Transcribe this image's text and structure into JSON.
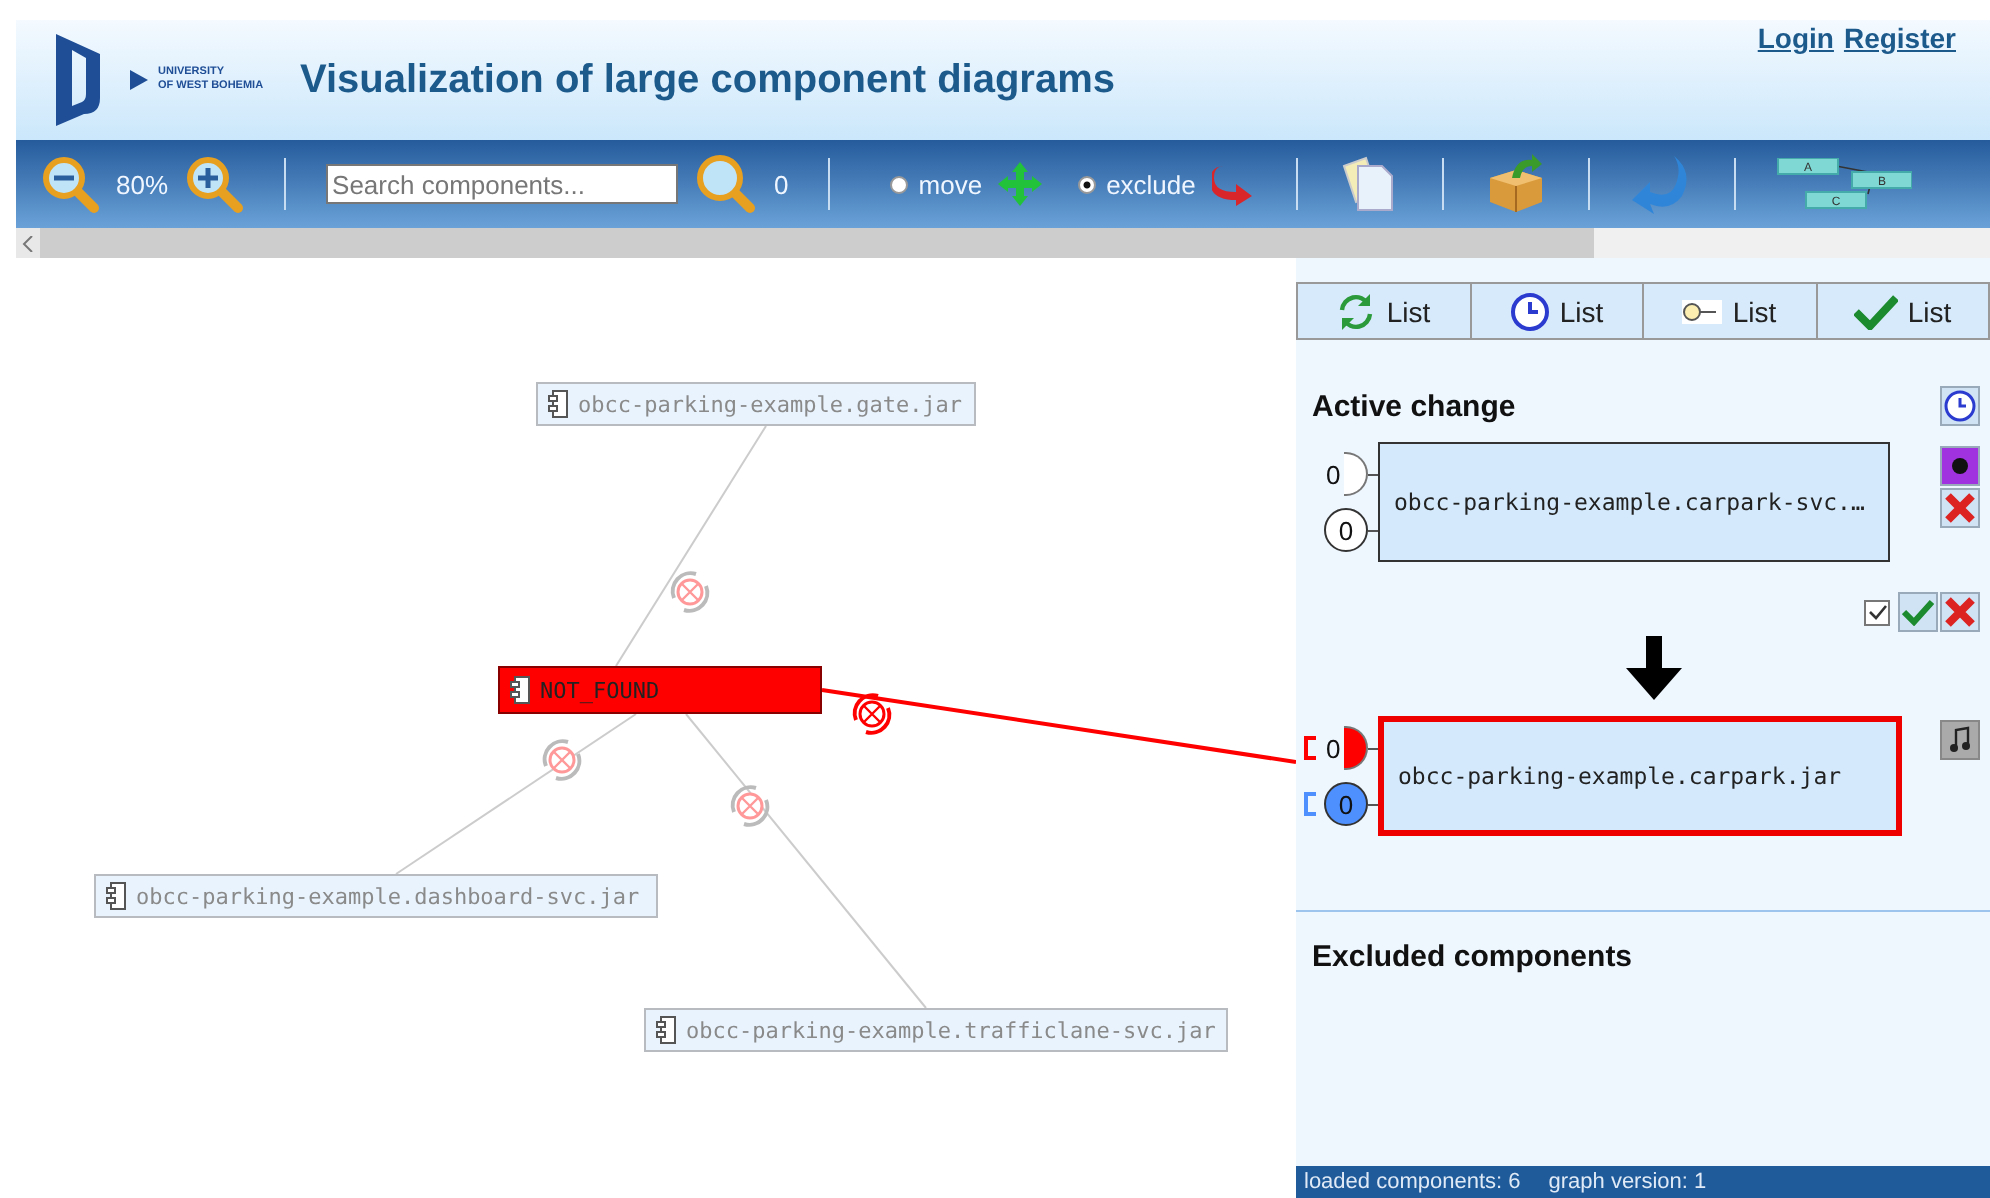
{
  "header": {
    "logo_lines": [
      "UNIVERSITY",
      "OF WEST BOHEMIA"
    ],
    "title": "Visualization of large component diagrams",
    "links": [
      "Login",
      "Register"
    ]
  },
  "toolbar": {
    "zoom": "80%",
    "search": {
      "placeholder": "Search components..."
    },
    "search_count": "0",
    "modes": [
      {
        "label": "move",
        "selected": false
      },
      {
        "label": "exclude",
        "selected": true
      }
    ],
    "layout_labels": [
      "A",
      "B",
      "C"
    ]
  },
  "diagram": {
    "nodes": [
      {
        "label": "obcc-parking-example.gate.jar",
        "kind": "normal"
      },
      {
        "label": "NOT_FOUND",
        "kind": "missing"
      },
      {
        "label": "obcc-parking-example.dashboard-svc.jar",
        "kind": "normal"
      },
      {
        "label": "obcc-parking-example.trafficlane-svc.jar",
        "kind": "normal"
      }
    ]
  },
  "panel": {
    "tabs": [
      {
        "kind": "refresh",
        "label": "List"
      },
      {
        "kind": "clock",
        "label": "List"
      },
      {
        "kind": "interface",
        "label": "List"
      },
      {
        "kind": "check",
        "label": "List"
      }
    ],
    "active_change": {
      "heading": "Active change",
      "accept_checked": true,
      "components": [
        {
          "name": "obcc-parking-example.carpark-svc.…",
          "highlighted": false,
          "ports": [
            {
              "kind": "required",
              "label": "0",
              "color": "#ffffff"
            },
            {
              "kind": "provided",
              "label": "0",
              "color": "#ffffff"
            }
          ]
        },
        {
          "name": "obcc-parking-example.carpark.jar",
          "highlighted": true,
          "ports": [
            {
              "kind": "required",
              "label": "0",
              "color": "#ff0000"
            },
            {
              "kind": "provided",
              "label": "0",
              "color": "#4d90fe"
            }
          ]
        }
      ]
    },
    "excluded_heading": "Excluded components"
  },
  "status_bar": [
    "loaded components: 6",
    "graph version: 1"
  ]
}
